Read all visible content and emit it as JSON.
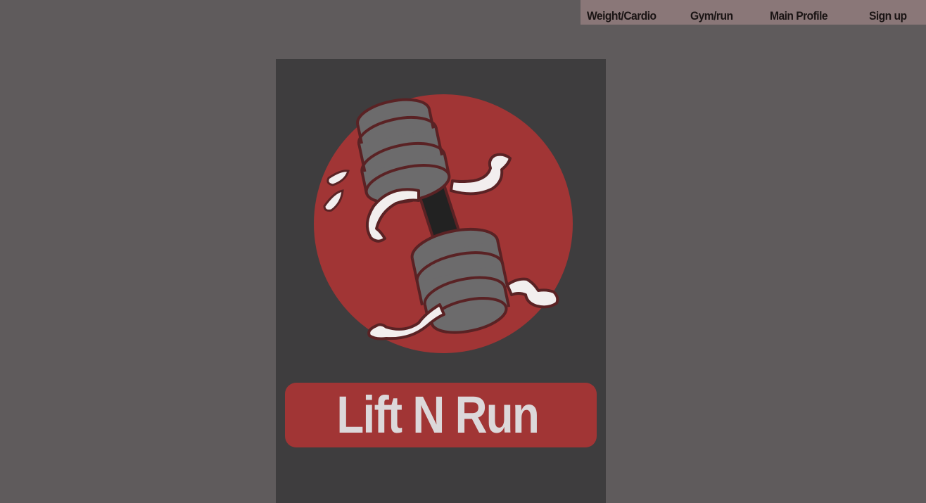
{
  "nav": {
    "items": [
      {
        "label": "Weight/Cardio"
      },
      {
        "label": "Gym/run"
      },
      {
        "label": "Main Profile"
      },
      {
        "label": "Sign up"
      }
    ]
  },
  "brand": {
    "title": "Lift N Run",
    "logo_icon": "running-dumbbell-icon",
    "colors": {
      "accent": "#a13535",
      "panel": "#3e3d3e",
      "background": "#5f5b5c",
      "nav": "#8a7778"
    }
  }
}
